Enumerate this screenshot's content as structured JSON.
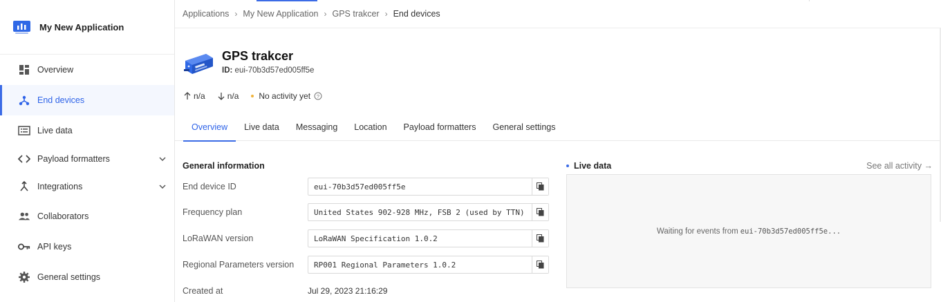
{
  "app": {
    "title": "My New Application"
  },
  "sidebar": {
    "items": [
      {
        "label": "Overview",
        "icon": "grid-icon"
      },
      {
        "label": "End devices",
        "icon": "end-devices-icon",
        "active": true
      },
      {
        "label": "Live data",
        "icon": "list-icon"
      },
      {
        "label": "Payload formatters",
        "icon": "code-icon",
        "expandable": true
      },
      {
        "label": "Integrations",
        "icon": "integrations-icon",
        "expandable": true
      },
      {
        "label": "Collaborators",
        "icon": "people-icon"
      },
      {
        "label": "API keys",
        "icon": "key-icon"
      },
      {
        "label": "General settings",
        "icon": "gear-icon"
      }
    ]
  },
  "breadcrumb": [
    "Applications",
    "My New Application",
    "GPS trakcer",
    "End devices"
  ],
  "device": {
    "title": "GPS trakcer",
    "id_label": "ID:",
    "id_value": "eui-70b3d57ed005ff5e"
  },
  "stats": {
    "up": "n/a",
    "down": "n/a",
    "activity": "No activity yet"
  },
  "tabs": [
    "Overview",
    "Live data",
    "Messaging",
    "Location",
    "Payload formatters",
    "General settings"
  ],
  "general": {
    "title": "General information",
    "rows": [
      {
        "label": "End device ID",
        "value": "eui-70b3d57ed005ff5e"
      },
      {
        "label": "Frequency plan",
        "value": "United States 902-928 MHz, FSB 2 (used by TTN)"
      },
      {
        "label": "LoRaWAN version",
        "value": "LoRaWAN Specification 1.0.2"
      },
      {
        "label": "Regional Parameters version",
        "value": "RP001 Regional Parameters 1.0.2"
      }
    ],
    "created_label": "Created at",
    "created_value": "Jul 29, 2023 21:16:29"
  },
  "live": {
    "title": "Live data",
    "see_all": "See all activity →",
    "waiting_prefix": "Waiting for events from",
    "waiting_id": "eui-70b3d57ed005ff5e..."
  },
  "colors": {
    "accent": "#3b6be6",
    "activity_dot": "#f0b33b"
  }
}
